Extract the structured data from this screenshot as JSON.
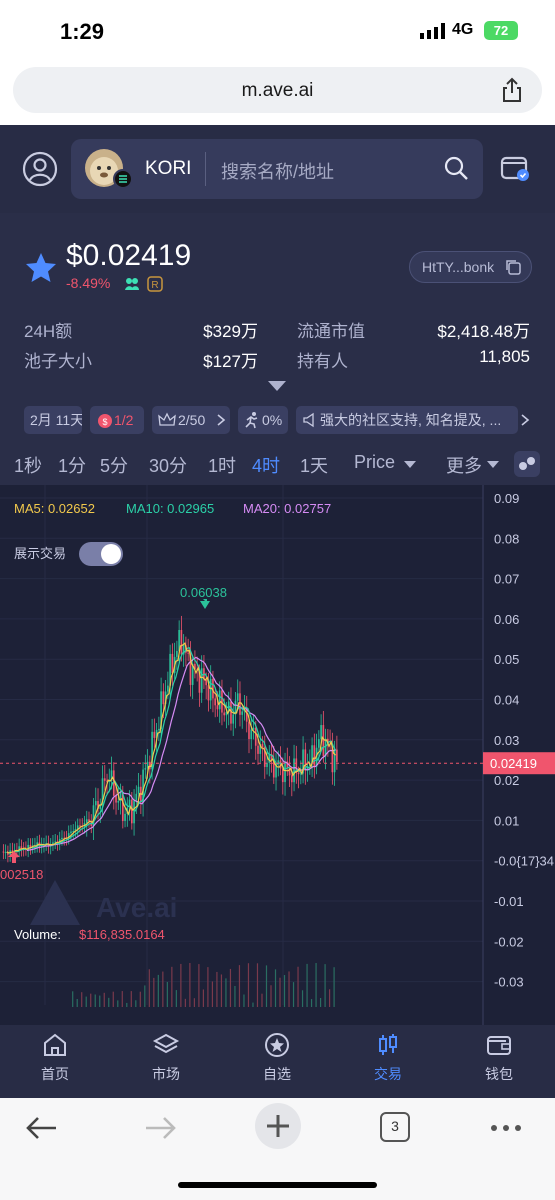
{
  "status": {
    "time": "1:29",
    "network": "4G",
    "battery": "72"
  },
  "browser": {
    "url": "m.ave.ai",
    "tab_count": "3"
  },
  "search": {
    "token_name": "KORI",
    "placeholder": "搜索名称/地址"
  },
  "token": {
    "price": "$0.02419",
    "change": "-8.49%",
    "address": "HtTY...bonk"
  },
  "stats": {
    "vol_label": "24H额",
    "vol_value": "$329万",
    "pool_label": "池子大小",
    "pool_value": "$127万",
    "mcap_label": "流通市值",
    "mcap_value": "$2,418.48万",
    "holders_label": "持有人",
    "holders_value": "11,805"
  },
  "tags": {
    "age": "2月 11天",
    "bag": "1/2",
    "crown": "2/50",
    "run": "0%",
    "desc": "强大的社区支持, 知名提及, ..."
  },
  "timeframes": {
    "t1": "1秒",
    "t2": "1分",
    "t3": "5分",
    "t4": "30分",
    "t5": "1时",
    "t6": "4时",
    "t7": "1天",
    "price": "Price",
    "more": "更多"
  },
  "chart": {
    "ma5": "MA5: 0.02652",
    "ma10": "MA10: 0.02965",
    "ma20": "MA20: 0.02757",
    "toggle_label": "展示交易",
    "high_label": "0.06038",
    "low_label": "002518",
    "current_label": "0.02419",
    "volume_label": "Volume:",
    "volume_value": "$116,835.0164",
    "watermark": "Ave.ai",
    "colors": {
      "up": "#2bc29a",
      "down": "#f0556d",
      "ma5": "#f2c94c",
      "ma10": "#2bd1a8",
      "ma20": "#d68cf5"
    }
  },
  "chart_data": {
    "type": "candlestick",
    "y_ticks": [
      "0.09",
      "0.08",
      "0.07",
      "0.06",
      "0.05",
      "0.04",
      "0.03",
      "0.02",
      "0.01",
      "-0.0{17}34",
      "-0.01",
      "-0.02",
      "-0.03"
    ],
    "ylim": [
      -0.03,
      0.09
    ],
    "current_price": 0.02419,
    "high": 0.06038,
    "low": 0.002518,
    "price_path": [
      0.002,
      0.002,
      0.003,
      0.003,
      0.004,
      0.004,
      0.004,
      0.005,
      0.006,
      0.008,
      0.009,
      0.011,
      0.015,
      0.022,
      0.016,
      0.012,
      0.013,
      0.018,
      0.025,
      0.033,
      0.042,
      0.05,
      0.055,
      0.048,
      0.046,
      0.044,
      0.04,
      0.038,
      0.036,
      0.04,
      0.034,
      0.03,
      0.026,
      0.024,
      0.023,
      0.022,
      0.022,
      0.024,
      0.025,
      0.031,
      0.028,
      0.024
    ]
  },
  "bottomnav": {
    "home": "首页",
    "market": "市场",
    "watch": "自选",
    "trade": "交易",
    "wallet": "钱包"
  }
}
